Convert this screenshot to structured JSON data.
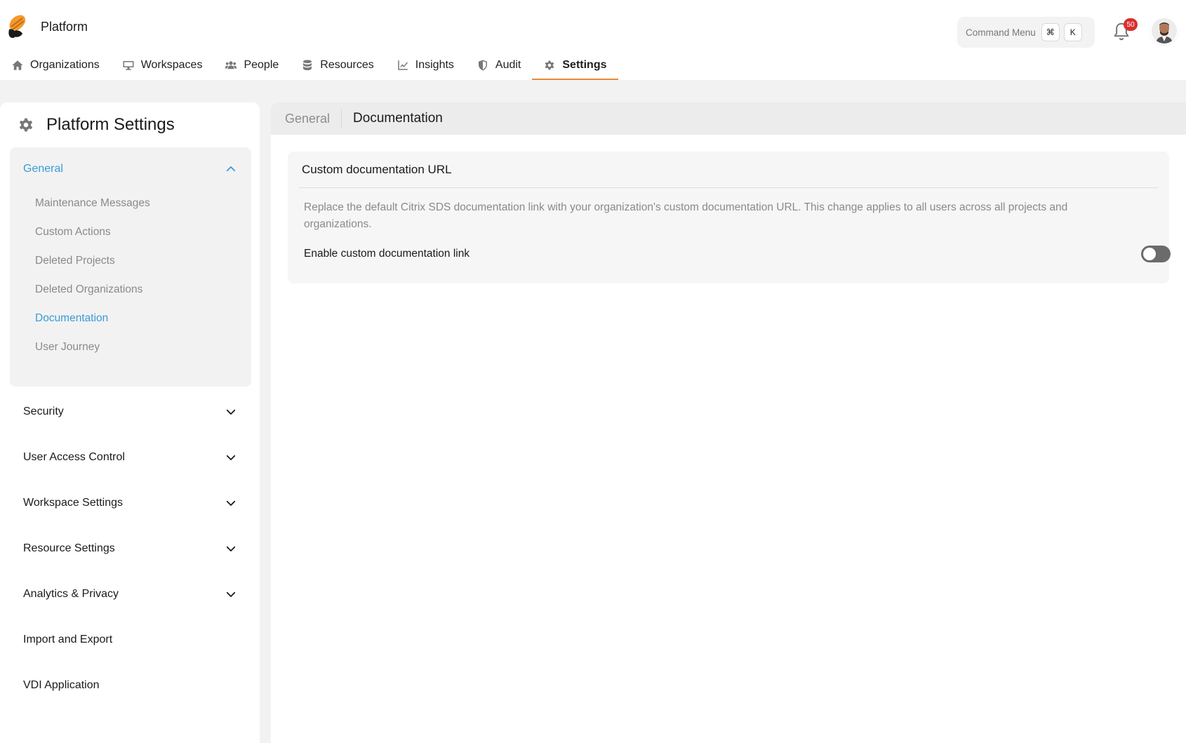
{
  "app": {
    "name": "Platform"
  },
  "header": {
    "command_menu": {
      "label": "Command Menu",
      "key1": "⌘",
      "key2": "K"
    },
    "notifications": {
      "count": "50"
    }
  },
  "nav": {
    "items": [
      {
        "label": "Organizations",
        "icon": "home-icon"
      },
      {
        "label": "Workspaces",
        "icon": "monitor-icon"
      },
      {
        "label": "People",
        "icon": "people-icon"
      },
      {
        "label": "Resources",
        "icon": "database-icon"
      },
      {
        "label": "Insights",
        "icon": "chart-line-icon"
      },
      {
        "label": "Audit",
        "icon": "shield-icon"
      },
      {
        "label": "Settings",
        "icon": "gear-icon",
        "active": true
      }
    ]
  },
  "sidebar": {
    "title": "Platform Settings",
    "general": {
      "label": "General",
      "items": [
        {
          "label": "Maintenance Messages"
        },
        {
          "label": "Custom Actions"
        },
        {
          "label": "Deleted Projects"
        },
        {
          "label": "Deleted Organizations"
        },
        {
          "label": "Documentation",
          "active": true
        },
        {
          "label": "User Journey"
        }
      ]
    },
    "sections": [
      {
        "label": "Security",
        "expandable": true
      },
      {
        "label": "User Access Control",
        "expandable": true
      },
      {
        "label": "Workspace Settings",
        "expandable": true
      },
      {
        "label": "Resource Settings",
        "expandable": true
      },
      {
        "label": "Analytics & Privacy",
        "expandable": true
      },
      {
        "label": "Import and Export",
        "expandable": false
      },
      {
        "label": "VDI Application",
        "expandable": false
      }
    ]
  },
  "main": {
    "breadcrumb": {
      "parent": "General",
      "current": "Documentation"
    },
    "card": {
      "title": "Custom documentation URL",
      "description": "Replace the default Citrix SDS documentation link with your organization's custom documentation URL. This change applies to all users across all projects and organizations.",
      "toggle_label": "Enable custom documentation link",
      "toggle_on": false
    }
  },
  "colors": {
    "accent": "#3a9bd8",
    "tab_underline": "#e58a3a",
    "badge": "#d7312e"
  }
}
